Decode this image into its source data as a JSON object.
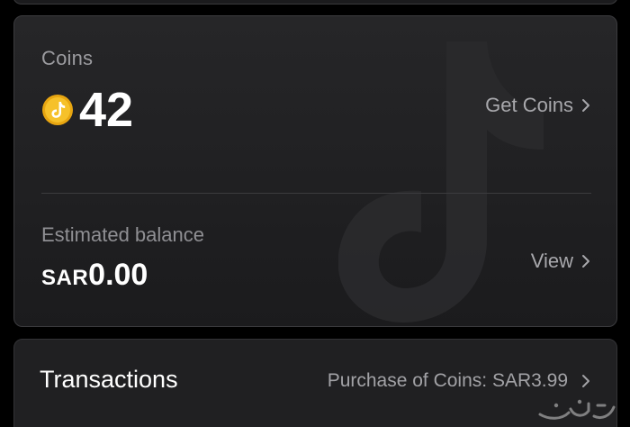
{
  "wallet": {
    "coins_label": "Coins",
    "coin_icon": "tiktok-coin-icon",
    "coin_balance": "42",
    "get_coins_label": "Get Coins",
    "estimated_label": "Estimated balance",
    "currency": "SAR",
    "balance_amount": "0.00",
    "view_label": "View"
  },
  "transactions": {
    "title": "Transactions",
    "latest": "Purchase of Coins: SAR3.99"
  },
  "icons": {
    "chevron": "chevron-right-icon",
    "watermark": "tiktok-logo-icon"
  },
  "colors": {
    "background": "#000000",
    "card": "#222224",
    "coin_gold": "#f3b816",
    "text_primary": "#ffffff",
    "text_secondary": "#9b9b9f"
  }
}
